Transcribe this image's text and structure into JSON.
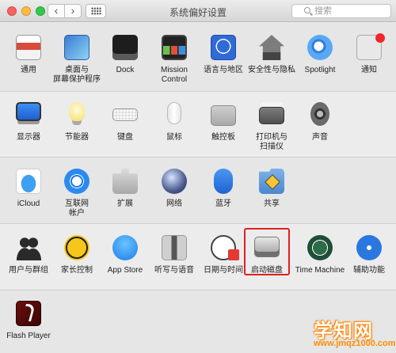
{
  "window": {
    "title": "系统偏好设置",
    "search_placeholder": "搜索",
    "back_glyph": "‹",
    "forward_glyph": "›"
  },
  "rows": [
    [
      {
        "label": "通用",
        "icon": "general-icon"
      },
      {
        "label": "桌面与\n屏幕保护程序",
        "icon": "desktop-screensaver-icon"
      },
      {
        "label": "Dock",
        "icon": "dock-icon"
      },
      {
        "label": "Mission\nControl",
        "icon": "mission-control-icon"
      },
      {
        "label": "语言与地区",
        "icon": "language-region-icon"
      },
      {
        "label": "安全性与隐私",
        "icon": "security-privacy-icon"
      },
      {
        "label": "Spotlight",
        "icon": "spotlight-icon"
      },
      {
        "label": "通知",
        "icon": "notifications-icon"
      }
    ],
    [
      {
        "label": "显示器",
        "icon": "displays-icon"
      },
      {
        "label": "节能器",
        "icon": "energy-saver-icon"
      },
      {
        "label": "键盘",
        "icon": "keyboard-icon"
      },
      {
        "label": "鼠标",
        "icon": "mouse-icon"
      },
      {
        "label": "触控板",
        "icon": "trackpad-icon"
      },
      {
        "label": "打印机与\n扫描仪",
        "icon": "printers-scanners-icon"
      },
      {
        "label": "声音",
        "icon": "sound-icon"
      }
    ],
    [
      {
        "label": "iCloud",
        "icon": "icloud-icon"
      },
      {
        "label": "互联网\n帐户",
        "icon": "internet-accounts-icon"
      },
      {
        "label": "扩展",
        "icon": "extensions-icon"
      },
      {
        "label": "网络",
        "icon": "network-icon"
      },
      {
        "label": "蓝牙",
        "icon": "bluetooth-icon"
      },
      {
        "label": "共享",
        "icon": "sharing-icon"
      }
    ],
    [
      {
        "label": "用户与群组",
        "icon": "users-groups-icon"
      },
      {
        "label": "家长控制",
        "icon": "parental-controls-icon"
      },
      {
        "label": "App Store",
        "icon": "app-store-icon"
      },
      {
        "label": "听写与语音",
        "icon": "dictation-speech-icon"
      },
      {
        "label": "日期与时间",
        "icon": "date-time-icon"
      },
      {
        "label": "启动磁盘",
        "icon": "startup-disk-icon"
      },
      {
        "label": "Time Machine",
        "icon": "time-machine-icon"
      },
      {
        "label": "辅助功能",
        "icon": "accessibility-icon"
      }
    ],
    [
      {
        "label": "Flash Player",
        "icon": "flash-player-icon"
      }
    ]
  ],
  "watermark": {
    "title": "学知网",
    "url": "www.jmqz1000.com"
  },
  "colors": {
    "highlight": "#e01f1f",
    "watermark": "#ff8c00"
  }
}
